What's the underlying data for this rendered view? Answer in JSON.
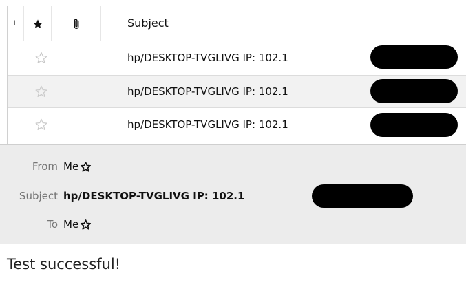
{
  "list": {
    "columns": {
      "thread_icon": "thread-icon",
      "star_icon": "star-filled-icon",
      "attachment_icon": "paperclip-icon",
      "subject_header": "Subject"
    },
    "rows": [
      {
        "subject": "hp/DESKTOP-TVGLIVG  IP: 102.1",
        "starred": false,
        "selected": false
      },
      {
        "subject": "hp/DESKTOP-TVGLIVG  IP: 102.1",
        "starred": false,
        "selected": true
      },
      {
        "subject": "hp/DESKTOP-TVGLIVG  IP: 102.1",
        "starred": false,
        "selected": false
      }
    ]
  },
  "preview": {
    "from_label": "From",
    "from_value": "Me",
    "subject_label": "Subject",
    "subject_value": "hp/DESKTOP-TVGLIVG IP: 102.1",
    "to_label": "To",
    "to_value": "Me"
  },
  "message_body": {
    "text": "Test successful!"
  },
  "colors": {
    "selected_row_bg": "#f2f2f2",
    "preview_bg": "#ececec",
    "redaction": "#000000"
  }
}
